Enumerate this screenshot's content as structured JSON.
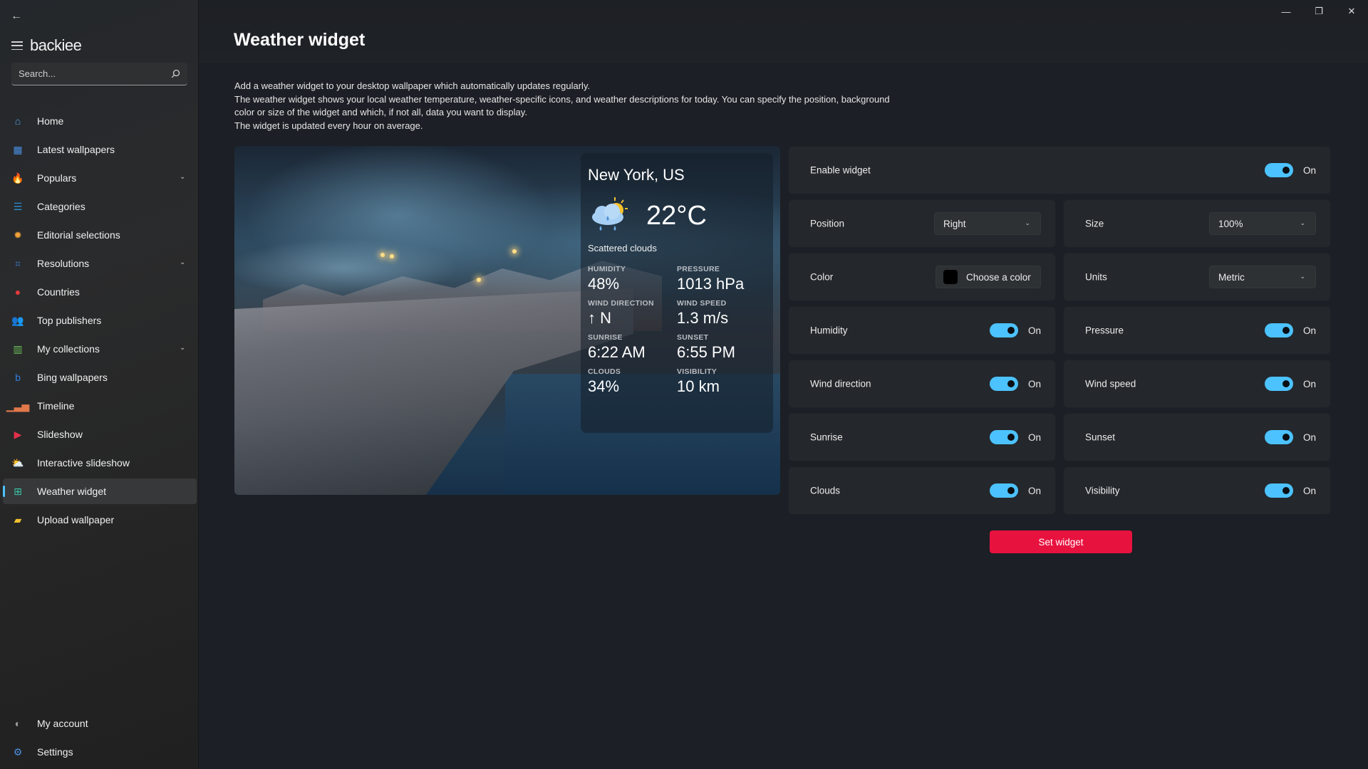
{
  "window": {
    "controls": {
      "minimize": "—",
      "maximize": "❐",
      "close": "✕"
    }
  },
  "sidebar": {
    "back_icon": "←",
    "brand": "backiee",
    "search": {
      "placeholder": "Search...",
      "value": ""
    },
    "items": [
      {
        "label": "Home",
        "icon": "home-icon",
        "glyph": "⌂",
        "color": "#5aa0e6",
        "expandable": false,
        "active": false
      },
      {
        "label": "Latest wallpapers",
        "icon": "calendar-icon",
        "glyph": "▦",
        "color": "#4a90e2",
        "expandable": false,
        "active": false
      },
      {
        "label": "Populars",
        "icon": "fire-icon",
        "glyph": "🔥",
        "color": "#f06a3a",
        "expandable": true,
        "active": false
      },
      {
        "label": "Categories",
        "icon": "list-icon",
        "glyph": "☰",
        "color": "#2a8fd6",
        "expandable": false,
        "active": false
      },
      {
        "label": "Editorial selections",
        "icon": "award-icon",
        "glyph": "✹",
        "color": "#f0a03a",
        "expandable": false,
        "active": false
      },
      {
        "label": "Resolutions",
        "icon": "crop-icon",
        "glyph": "⌗",
        "color": "#3a7ed6",
        "expandable": true,
        "active": false
      },
      {
        "label": "Countries",
        "icon": "map-pin-icon",
        "glyph": "●",
        "color": "#e23a3a",
        "expandable": false,
        "active": false
      },
      {
        "label": "Top publishers",
        "icon": "people-icon",
        "glyph": "👥",
        "color": "#3ab6d6",
        "expandable": false,
        "active": false
      },
      {
        "label": "My collections",
        "icon": "books-icon",
        "glyph": "▥",
        "color": "#6bbf5a",
        "expandable": true,
        "active": false
      },
      {
        "label": "Bing wallpapers",
        "icon": "bing-icon",
        "glyph": "b",
        "color": "#2f7fe0",
        "expandable": false,
        "active": false
      },
      {
        "label": "Timeline",
        "icon": "chart-icon",
        "glyph": "▁▃▅",
        "color": "#e0784a",
        "expandable": false,
        "active": false
      },
      {
        "label": "Slideshow",
        "icon": "play-icon",
        "glyph": "▶",
        "color": "#e5304a",
        "expandable": false,
        "active": false
      },
      {
        "label": "Interactive slideshow",
        "icon": "weather-sun-cloud-icon",
        "glyph": "⛅",
        "color": "#f0c040",
        "expandable": false,
        "active": false
      },
      {
        "label": "Weather widget",
        "icon": "grid-icon",
        "glyph": "⊞",
        "color": "#3ac6a8",
        "expandable": false,
        "active": true
      },
      {
        "label": "Upload wallpaper",
        "icon": "folder-upload-icon",
        "glyph": "▰",
        "color": "#f0c030",
        "expandable": false,
        "active": false
      }
    ],
    "bottom_items": [
      {
        "label": "My account",
        "icon": "avatar-icon",
        "glyph": "◐",
        "color": "#a0a0a0"
      },
      {
        "label": "Settings",
        "icon": "gear-icon",
        "glyph": "⚙",
        "color": "#4a90e2"
      }
    ]
  },
  "page": {
    "title": "Weather widget",
    "description": [
      "Add a weather widget to your desktop wallpaper which automatically updates regularly.",
      "The weather widget shows your local weather temperature, weather-specific icons, and weather descriptions for today. You can specify the position, background",
      "color or size of the widget and which, if not all, data you want to display.",
      "The widget is updated every hour on average."
    ]
  },
  "preview": {
    "city": "New York, US",
    "temperature": "22°C",
    "condition": "Scattered clouds",
    "condition_icon": "cloud-sun-rain-icon",
    "stats": [
      {
        "label": "HUMIDITY",
        "value": "48%"
      },
      {
        "label": "PRESSURE",
        "value": "1013 hPa"
      },
      {
        "label": "WIND DIRECTION",
        "value": "↑ N"
      },
      {
        "label": "WIND SPEED",
        "value": "1.3 m/s"
      },
      {
        "label": "SUNRISE",
        "value": "6:22 AM"
      },
      {
        "label": "SUNSET",
        "value": "6:55 PM"
      },
      {
        "label": "CLOUDS",
        "value": "34%"
      },
      {
        "label": "VISIBILITY",
        "value": "10 km"
      }
    ]
  },
  "settings": {
    "enable_widget": {
      "label": "Enable widget",
      "state": "On",
      "on": true
    },
    "position": {
      "label": "Position",
      "value": "Right"
    },
    "size": {
      "label": "Size",
      "value": "100%"
    },
    "color": {
      "label": "Color",
      "button_label": "Choose a color",
      "swatch": "#000000"
    },
    "units": {
      "label": "Units",
      "value": "Metric"
    },
    "toggles": [
      {
        "label": "Humidity",
        "state": "On",
        "on": true
      },
      {
        "label": "Pressure",
        "state": "On",
        "on": true
      },
      {
        "label": "Wind direction",
        "state": "On",
        "on": true
      },
      {
        "label": "Wind speed",
        "state": "On",
        "on": true
      },
      {
        "label": "Sunrise",
        "state": "On",
        "on": true
      },
      {
        "label": "Sunset",
        "state": "On",
        "on": true
      },
      {
        "label": "Clouds",
        "state": "On",
        "on": true
      },
      {
        "label": "Visibility",
        "state": "On",
        "on": true
      }
    ],
    "submit_label": "Set widget",
    "accent": "#4cc2ff",
    "submit_color": "#e8123f"
  }
}
